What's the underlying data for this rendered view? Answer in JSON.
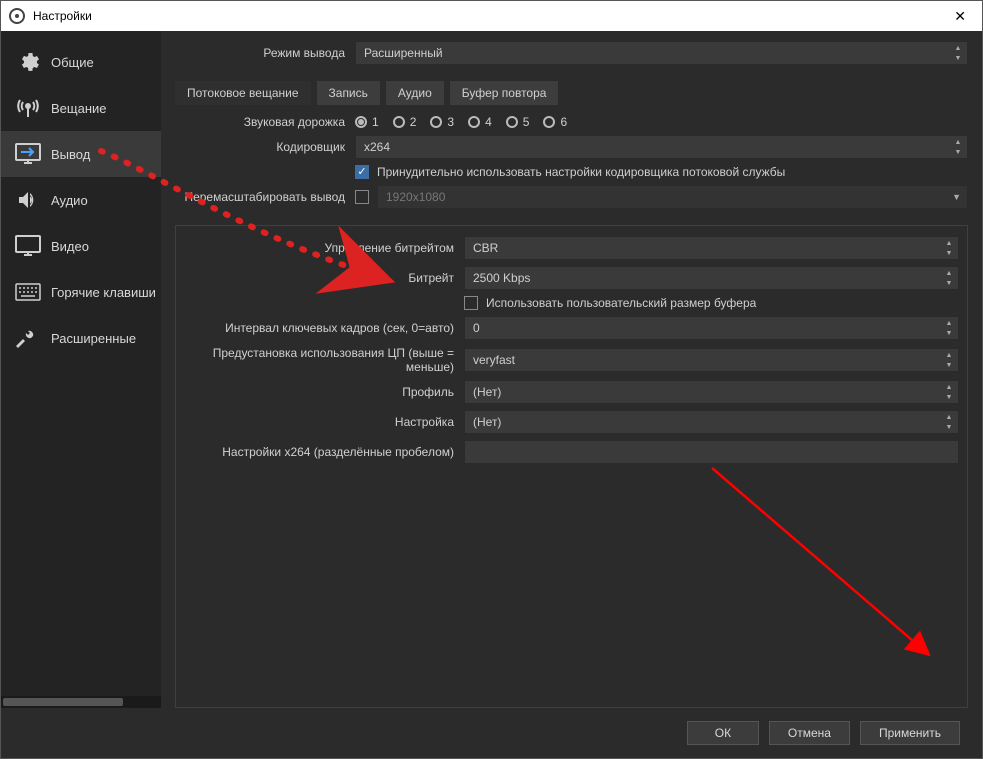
{
  "window": {
    "title": "Настройки"
  },
  "sidebar": {
    "items": [
      {
        "label": "Общие"
      },
      {
        "label": "Вещание"
      },
      {
        "label": "Вывод"
      },
      {
        "label": "Аудио"
      },
      {
        "label": "Видео"
      },
      {
        "label": "Горячие клавиши"
      },
      {
        "label": "Расширенные"
      }
    ]
  },
  "mode": {
    "label": "Режим вывода",
    "value": "Расширенный"
  },
  "tabs": [
    {
      "label": "Потоковое вещание"
    },
    {
      "label": "Запись"
    },
    {
      "label": "Аудио"
    },
    {
      "label": "Буфер повтора"
    }
  ],
  "fields": {
    "audio_track_label": "Звуковая дорожка",
    "tracks": [
      "1",
      "2",
      "3",
      "4",
      "5",
      "6"
    ],
    "encoder_label": "Кодировщик",
    "encoder_value": "x264",
    "enforce_label": "Принудительно использовать настройки кодировщика потоковой службы",
    "rescale_label": "Перемасштабировать вывод",
    "rescale_value": "1920x1080",
    "rate_control_label": "Управление битрейтом",
    "rate_control_value": "CBR",
    "bitrate_label": "Битрейт",
    "bitrate_value": "2500 Kbps",
    "custom_buffer_label": "Использовать пользовательский размер буфера",
    "keyint_label": "Интервал ключевых кадров (сек, 0=авто)",
    "keyint_value": "0",
    "preset_label": "Предустановка использования ЦП (выше = меньше)",
    "preset_value": "veryfast",
    "profile_label": "Профиль",
    "profile_value": "(Нет)",
    "tune_label": "Настройка",
    "tune_value": "(Нет)",
    "x264opts_label": "Настройки x264 (разделённые пробелом)",
    "x264opts_value": ""
  },
  "buttons": {
    "ok": "ОК",
    "cancel": "Отмена",
    "apply": "Применить"
  }
}
